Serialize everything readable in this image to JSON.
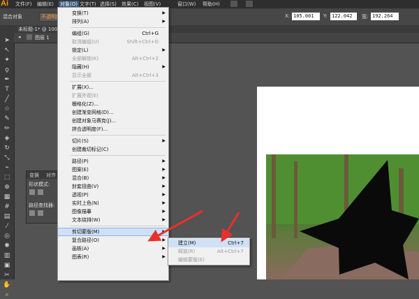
{
  "app": {
    "logo": "Ai"
  },
  "menubar": [
    "文件(F)",
    "编辑(E)",
    "对象(O)",
    "文字(T)",
    "选择(S)",
    "效果(C)",
    "视图(V)",
    "窗口(W)",
    "帮助(H)"
  ],
  "control": {
    "left_label": "混合对象",
    "opacity_label": "不透明度",
    "x": "105.001",
    "y": "122.042",
    "w": "192.264",
    "x_label": "X:",
    "y_label": "Y:",
    "w_label": "宽:"
  },
  "document": {
    "tab": "未标题-1* @ 100%",
    "breadcrumb": "图层 1"
  },
  "panel": {
    "tab1": "变换",
    "tab2": "对齐",
    "label1": "形状模式:",
    "label2": "路径查找器:"
  },
  "menu": [
    {
      "label": "变换(T)",
      "shortcut": "",
      "arrow": true,
      "disabled": false
    },
    {
      "label": "排列(A)",
      "shortcut": "",
      "arrow": true,
      "disabled": false
    },
    {
      "sep": true
    },
    {
      "label": "编组(G)",
      "shortcut": "Ctrl+G",
      "arrow": false,
      "disabled": false
    },
    {
      "label": "取消编组(U)",
      "shortcut": "Shift+Ctrl+G",
      "arrow": false,
      "disabled": true
    },
    {
      "label": "锁定(L)",
      "shortcut": "",
      "arrow": true,
      "disabled": false
    },
    {
      "label": "全部解锁(K)",
      "shortcut": "Alt+Ctrl+2",
      "arrow": false,
      "disabled": true
    },
    {
      "label": "隐藏(H)",
      "shortcut": "",
      "arrow": true,
      "disabled": false
    },
    {
      "label": "显示全部",
      "shortcut": "Alt+Ctrl+3",
      "arrow": false,
      "disabled": true
    },
    {
      "sep": true
    },
    {
      "label": "扩展(X)...",
      "shortcut": "",
      "arrow": false,
      "disabled": false
    },
    {
      "label": "扩展外观(E)",
      "shortcut": "",
      "arrow": false,
      "disabled": true
    },
    {
      "label": "栅格化(Z)...",
      "shortcut": "",
      "arrow": false,
      "disabled": false
    },
    {
      "label": "创建渐变网格(D)...",
      "shortcut": "",
      "arrow": false,
      "disabled": false
    },
    {
      "label": "创建对象马赛克(J)...",
      "shortcut": "",
      "arrow": false,
      "disabled": false
    },
    {
      "label": "拼合透明度(F)...",
      "shortcut": "",
      "arrow": false,
      "disabled": false
    },
    {
      "sep": true
    },
    {
      "label": "切片(S)",
      "shortcut": "",
      "arrow": true,
      "disabled": false
    },
    {
      "label": "创建裁切标记(C)",
      "shortcut": "",
      "arrow": false,
      "disabled": false
    },
    {
      "sep": true
    },
    {
      "label": "路径(P)",
      "shortcut": "",
      "arrow": true,
      "disabled": false
    },
    {
      "label": "图案(E)",
      "shortcut": "",
      "arrow": true,
      "disabled": false
    },
    {
      "label": "混合(B)",
      "shortcut": "",
      "arrow": true,
      "disabled": false
    },
    {
      "label": "封套扭曲(V)",
      "shortcut": "",
      "arrow": true,
      "disabled": false
    },
    {
      "label": "透视(P)",
      "shortcut": "",
      "arrow": true,
      "disabled": false
    },
    {
      "label": "实时上色(N)",
      "shortcut": "",
      "arrow": true,
      "disabled": false
    },
    {
      "label": "图像描摹",
      "shortcut": "",
      "arrow": true,
      "disabled": false
    },
    {
      "label": "文本绕排(W)",
      "shortcut": "",
      "arrow": true,
      "disabled": false
    },
    {
      "sep": true
    },
    {
      "label": "剪切蒙版(M)",
      "shortcut": "",
      "arrow": true,
      "disabled": false,
      "highlight": true
    },
    {
      "label": "复合路径(O)",
      "shortcut": "",
      "arrow": true,
      "disabled": false
    },
    {
      "label": "画板(A)",
      "shortcut": "",
      "arrow": true,
      "disabled": false
    },
    {
      "label": "图表(R)",
      "shortcut": "",
      "arrow": true,
      "disabled": false
    }
  ],
  "submenu": [
    {
      "label": "建立(M)",
      "shortcut": "Ctrl+7",
      "disabled": false,
      "highlight": true
    },
    {
      "label": "释放(R)",
      "shortcut": "Alt+Ctrl+7",
      "disabled": true
    },
    {
      "label": "编辑蒙版(E)",
      "shortcut": "",
      "disabled": true
    }
  ],
  "colors": {
    "menubar": "#2e2e2e",
    "menu_bg": "#f0f0f0",
    "highlight": "#cfe0f7",
    "arrow": "#e8302a",
    "accent": "#ff9a00"
  }
}
